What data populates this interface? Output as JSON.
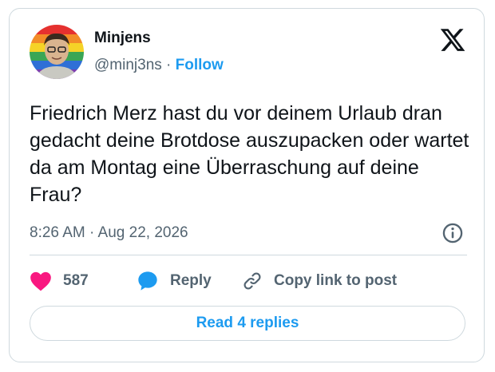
{
  "author": {
    "name": "Minjens",
    "handle": "@minj3ns",
    "separator": "·",
    "follow_label": "Follow"
  },
  "tweet": {
    "text": "Friedrich Merz hast du vor deinem Urlaub dran gedacht deine Brotdose auszupacken oder wartet da am Montag eine Überraschung auf deine Frau?",
    "timestamp": "8:26 AM · Aug 22, 2026"
  },
  "actions": {
    "likes": "587",
    "reply_label": "Reply",
    "copy_label": "Copy link to post"
  },
  "replies_button": "Read 4 replies",
  "icons": {
    "logo": "x-logo-icon",
    "info": "info-icon",
    "like": "heart-icon",
    "reply": "speech-bubble-icon",
    "copy": "link-icon"
  },
  "colors": {
    "accent": "#1d9bf0",
    "like": "#f91880",
    "text": "#0f1419",
    "muted": "#536471",
    "border": "#cfd9de"
  }
}
